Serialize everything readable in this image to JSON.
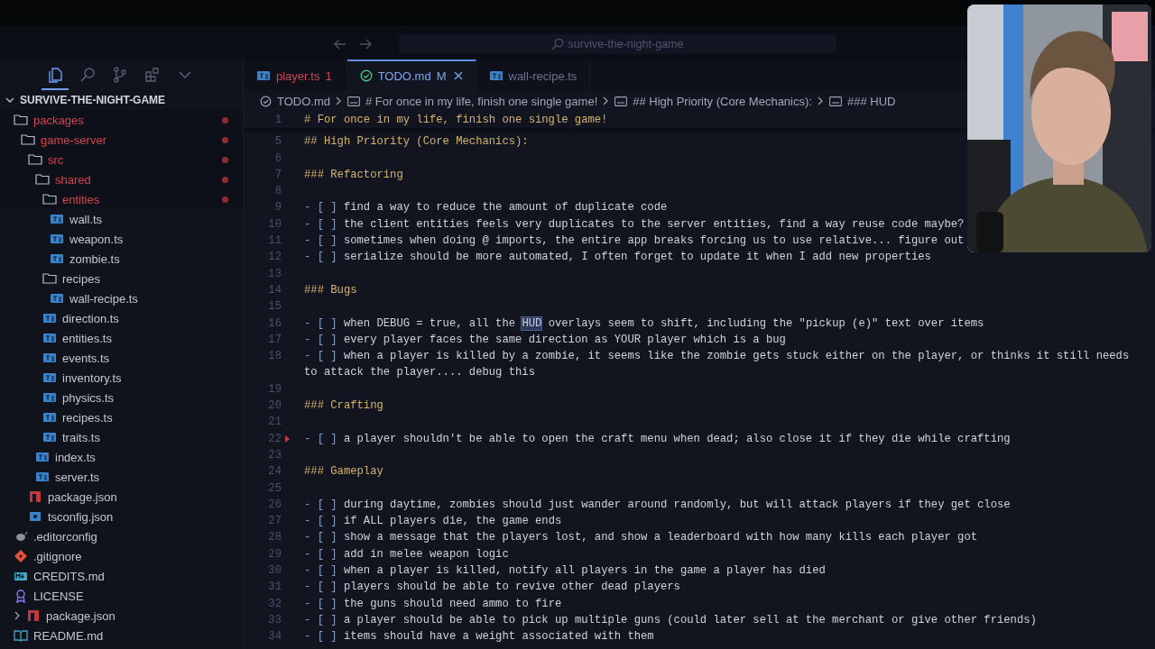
{
  "window": {
    "search": "survive-the-night-game"
  },
  "sidebar": {
    "views": [
      {
        "kind": "explorer",
        "selected": true
      },
      {
        "kind": "search",
        "selected": false
      },
      {
        "kind": "source-control",
        "selected": false
      },
      {
        "kind": "extensions",
        "selected": false
      },
      {
        "kind": "more",
        "selected": false
      }
    ],
    "title": "SURVIVE-THE-NIGHT-GAME",
    "expanded": true,
    "tree": [
      {
        "name": "packages",
        "kind": "folder",
        "modified": true,
        "sticky": true,
        "children": [
          {
            "name": "game-server",
            "kind": "folder",
            "modified": true,
            "sticky": true,
            "children": [
              {
                "name": "src",
                "kind": "folder",
                "modified": true,
                "sticky": true,
                "children": [
                  {
                    "name": "shared",
                    "kind": "folder",
                    "modified": true,
                    "sticky": true,
                    "children": [
                      {
                        "name": "entities",
                        "kind": "folder",
                        "modified": true,
                        "sticky": true,
                        "children": [
                          {
                            "name": "wall.ts",
                            "kind": "ts"
                          },
                          {
                            "name": "weapon.ts",
                            "kind": "ts"
                          },
                          {
                            "name": "zombie.ts",
                            "kind": "ts"
                          }
                        ]
                      },
                      {
                        "name": "recipes",
                        "kind": "folder",
                        "children": [
                          {
                            "name": "wall-recipe.ts",
                            "kind": "ts"
                          }
                        ]
                      },
                      {
                        "name": "direction.ts",
                        "kind": "ts"
                      },
                      {
                        "name": "entities.ts",
                        "kind": "ts"
                      },
                      {
                        "name": "events.ts",
                        "kind": "ts"
                      },
                      {
                        "name": "inventory.ts",
                        "kind": "ts"
                      },
                      {
                        "name": "physics.ts",
                        "kind": "ts"
                      },
                      {
                        "name": "recipes.ts",
                        "kind": "ts"
                      },
                      {
                        "name": "traits.ts",
                        "kind": "ts"
                      }
                    ]
                  },
                  {
                    "name": "index.ts",
                    "kind": "ts"
                  },
                  {
                    "name": "server.ts",
                    "kind": "ts"
                  }
                ]
              },
              {
                "name": "package.json",
                "kind": "npm"
              },
              {
                "name": "tsconfig.json",
                "kind": "tsconfig"
              }
            ]
          }
        ]
      },
      {
        "name": ".editorconfig",
        "kind": "editorconfig"
      },
      {
        "name": ".gitignore",
        "kind": "git"
      },
      {
        "name": "CREDITS.md",
        "kind": "markdown"
      },
      {
        "name": "LICENSE",
        "kind": "license"
      },
      {
        "name": "package.json",
        "kind": "npm",
        "expanded": false
      },
      {
        "name": "README.md",
        "kind": "readme"
      }
    ]
  },
  "tabs": [
    {
      "label": "player.ts",
      "badge": "1",
      "kind": "ts",
      "error": true,
      "modified": false,
      "selected": false
    },
    {
      "label": "TODO.md",
      "badge": "M",
      "kind": "todo",
      "error": false,
      "modified": true,
      "selected": true
    },
    {
      "label": "wall-recipe.ts",
      "kind": "ts",
      "error": false,
      "modified": false,
      "selected": false
    }
  ],
  "breadcrumb": [
    {
      "kind": "file",
      "text": "TODO.md"
    },
    {
      "kind": "heading",
      "text": "# For once in my life, finish one single game!"
    },
    {
      "kind": "heading",
      "text": "## High Priority (Core Mechanics):"
    },
    {
      "kind": "heading",
      "text": "### HUD"
    }
  ],
  "editor": {
    "sticky": [
      {
        "number": "1",
        "kind": "heading",
        "text": "# For once in my life, finish one single game!"
      }
    ],
    "lines": [
      {
        "number": "5",
        "kind": "heading",
        "text": "## High Priority (Core Mechanics):"
      },
      {
        "number": "6",
        "kind": "blank"
      },
      {
        "number": "7",
        "kind": "heading",
        "text": "### Refactoring"
      },
      {
        "number": "8",
        "kind": "blank"
      },
      {
        "number": "9",
        "kind": "task",
        "marker": "- [ ]",
        "text": "find a way to reduce the amount of duplicate code"
      },
      {
        "number": "10",
        "kind": "task",
        "marker": "- [ ]",
        "text": "the client entities feels very duplicates to the server entities, find a way reuse code maybe?"
      },
      {
        "number": "11",
        "kind": "task",
        "marker": "- [ ]",
        "text": "sometimes when doing @ imports, the entire app breaks forcing us to use relative... figure out"
      },
      {
        "number": "12",
        "kind": "task",
        "marker": "- [ ]",
        "text": "serialize should be more automated, I often forget to update it when I add new properties"
      },
      {
        "number": "13",
        "kind": "blank"
      },
      {
        "number": "14",
        "kind": "heading",
        "text": "### Bugs"
      },
      {
        "number": "15",
        "kind": "blank"
      },
      {
        "number": "16",
        "kind": "task",
        "marker": "- [ ]",
        "parts": [
          {
            "text": "when DEBUG = true, all the ",
            "selected": false
          },
          {
            "text": "HUD",
            "selected": true
          },
          {
            "text": " overlays seem to shift, including the \"pickup (e)\" text over items",
            "selected": false
          }
        ]
      },
      {
        "number": "17",
        "kind": "task",
        "marker": "- [ ]",
        "text": "every player faces the same direction as YOUR player which is a bug"
      },
      {
        "number": "18",
        "kind": "task",
        "marker": "- [ ]",
        "text": "when a player is killed by a zombie, it seems like the zombie gets stuck either on the player, or thinks it still needs to attack the player.... debug this"
      },
      {
        "number": "19",
        "kind": "blank"
      },
      {
        "number": "20",
        "kind": "heading",
        "text": "### Crafting"
      },
      {
        "number": "21",
        "kind": "blank"
      },
      {
        "number": "22",
        "kind": "task",
        "marker": "- [ ]",
        "text": "a player shouldn't be able to open the craft menu when dead; also close it if they die while crafting",
        "gutter_mark": true
      },
      {
        "number": "23",
        "kind": "blank"
      },
      {
        "number": "24",
        "kind": "heading",
        "text": "### Gameplay"
      },
      {
        "number": "25",
        "kind": "blank"
      },
      {
        "number": "26",
        "kind": "task",
        "marker": "- [ ]",
        "text": "during daytime, zombies should just wander around randomly, but will attack players if they get close"
      },
      {
        "number": "27",
        "kind": "task",
        "marker": "- [ ]",
        "text": "if ALL players die, the game ends"
      },
      {
        "number": "28",
        "kind": "task",
        "marker": "- [ ]",
        "text": "show a message that the players lost, and show a leaderboard with how many kills each player got"
      },
      {
        "number": "29",
        "kind": "task",
        "marker": "- [ ]",
        "text": "add in melee weapon logic"
      },
      {
        "number": "30",
        "kind": "task",
        "marker": "- [ ]",
        "text": "when a player is killed, notify all players in the game a player has died"
      },
      {
        "number": "31",
        "kind": "task",
        "marker": "- [ ]",
        "text": "players should be able to revive other dead players"
      },
      {
        "number": "32",
        "kind": "task",
        "marker": "- [ ]",
        "text": "the guns should need ammo to fire"
      },
      {
        "number": "33",
        "kind": "task",
        "marker": "- [ ]",
        "text": "a player should be able to pick up multiple guns (could later sell at the merchant or give other friends)"
      },
      {
        "number": "34",
        "kind": "task",
        "marker": "- [ ]",
        "text": "items should have a weight associated with them"
      }
    ]
  }
}
